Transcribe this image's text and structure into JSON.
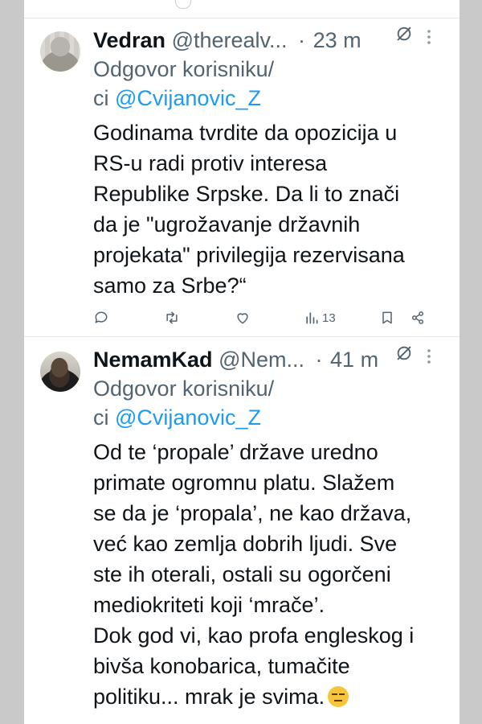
{
  "tweets": [
    {
      "name": "Vedran",
      "handle": "@therealv...",
      "separator": "·",
      "time": "23 m",
      "reply_prefix": "Odgovor korisniku/",
      "reply_ci": "ci ",
      "reply_mention": "@Cvijanovic_Z",
      "body_lines": [
        "Godinama tvrdite da opozicija u",
        "RS-u radi protiv interesa",
        "Republike Srpske. Da li to znači",
        "da je \"ugrožavanje državnih",
        "projekata\" privilegija rezervisana",
        "samo za Srbe?“"
      ],
      "views": "13",
      "icons": [
        "reply-icon",
        "retweet-icon",
        "like-icon",
        "views-icon",
        "bookmark-icon",
        "share-icon"
      ]
    },
    {
      "name": "NemamKad",
      "handle": "@Nem...",
      "separator": "·",
      "time": "41 m",
      "reply_prefix": "Odgovor korisniku/",
      "reply_ci": "ci ",
      "reply_mention": "@Cvijanovic_Z",
      "body_lines": [
        "Od te ‘propale’ države uredno",
        "primate ogromnu platu. Slažem",
        "se da je ‘propala’, ne kao država,",
        "već kao zemlja dobrih ljudi. Sve",
        "ste ih oterali, ostali su ogorčeni",
        "mediokriteti koji ‘mrače’.",
        "Dok god vi, kao profa engleskog i",
        "bivša konobarica, tumačite",
        "politiku... mrak je svima."
      ],
      "trailing_emoji": "expressionless-face-emoji"
    }
  ],
  "colors": {
    "text": "#0f1419",
    "secondary": "#536471",
    "link": "#1d9bf0",
    "background_outer": "#c9c9c9"
  }
}
